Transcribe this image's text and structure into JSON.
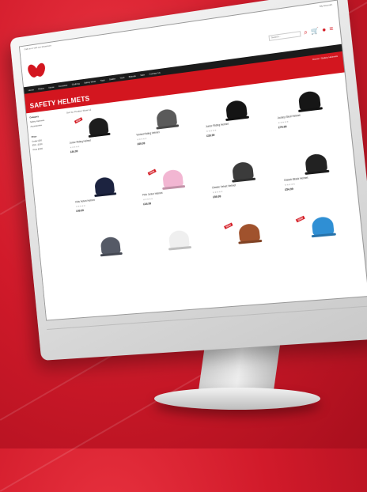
{
  "topbar": {
    "left": "Call us or visit our showroom",
    "right": "My Account"
  },
  "header": {
    "logo_text": "",
    "search_placeholder": "Search..."
  },
  "nav": [
    "Home",
    "Riders",
    "Horse",
    "Footwear",
    "Clothing",
    "Safety Wear",
    "Tack",
    "Stable",
    "Yard",
    "Brands",
    "Sale",
    "Contact Us"
  ],
  "banner": {
    "title": "SAFETY HELMETS",
    "crumb": "Home / Safety Helmets"
  },
  "sidebar": {
    "groups": [
      {
        "title": "Category",
        "rows": [
          [
            "Safety Helmets",
            ""
          ],
          [
            "Accessories",
            ""
          ]
        ]
      },
      {
        "title": "Price",
        "rows": [
          [
            "Under £50",
            ""
          ],
          [
            "£50 - £100",
            ""
          ],
          [
            "Over £100",
            ""
          ]
        ]
      }
    ]
  },
  "toolbar": "Sort by: Position  Show 12",
  "products": [
    {
      "name": "Junior Riding Helmet",
      "price": "£44.99",
      "color": "#1d1d1d",
      "new": "NEW"
    },
    {
      "name": "Vented Riding Helmet",
      "price": "£69.99",
      "color": "#5a5a5a",
      "new": ""
    },
    {
      "name": "Junior Riding Helmet",
      "price": "£39.99",
      "color": "#141414",
      "new": ""
    },
    {
      "name": "Jockey Skull Helmet",
      "price": "£79.99",
      "color": "#161616",
      "new": ""
    },
    {
      "name": "Kids Velvet Helmet",
      "price": "£49.99",
      "color": "#1c2340",
      "new": ""
    },
    {
      "name": "Pink Junior Helmet",
      "price": "£44.99",
      "color": "#f2b6d2",
      "new": "NEW"
    },
    {
      "name": "Classic Velvet Helmet",
      "price": "£59.99",
      "color": "#3b3b3b",
      "new": ""
    },
    {
      "name": "Classic Black Helmet",
      "price": "£54.99",
      "color": "#222222",
      "new": ""
    },
    {
      "name": "",
      "price": "",
      "color": "#555a66",
      "new": ""
    },
    {
      "name": "",
      "price": "",
      "color": "#efefef",
      "new": ""
    },
    {
      "name": "",
      "price": "",
      "color": "#a0522d",
      "new": "NEW"
    },
    {
      "name": "",
      "price": "",
      "color": "#2f8fd4",
      "new": "NEW"
    }
  ]
}
